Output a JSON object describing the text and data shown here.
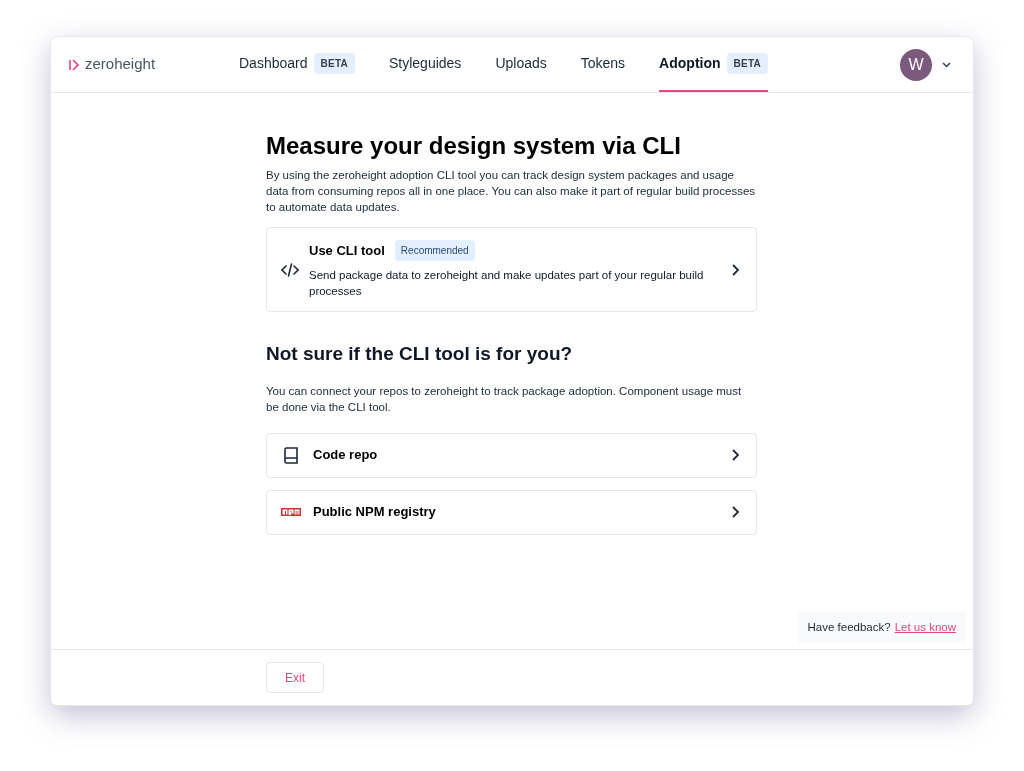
{
  "brand": {
    "name": "zeroheight"
  },
  "nav": [
    {
      "label": "Dashboard",
      "badge": "BETA",
      "selected": false
    },
    {
      "label": "Styleguides",
      "selected": false
    },
    {
      "label": "Uploads",
      "selected": false
    },
    {
      "label": "Tokens",
      "selected": false
    },
    {
      "label": "Adoption",
      "badge": "BETA",
      "selected": true
    }
  ],
  "user": {
    "initial": "W"
  },
  "heading": "Measure your design system via CLI",
  "intro": "By using the zeroheight adoption CLI tool you can track design system packages and usage data from consuming repos all in one place. You can also make it part of regular build processes to automate data updates.",
  "primary_options": [
    {
      "kind": "code",
      "title": "Use CLI tool",
      "badge": "Recommended",
      "description": "Send package data to zeroheight and make updates part of your regular build processes"
    }
  ],
  "secondary_heading": "Not sure if the CLI tool is for you?",
  "secondary_intro": "You can connect your repos to zeroheight to track package adoption. Component usage must be done via the CLI tool.",
  "secondary_options": [
    {
      "kind": "book",
      "title": "Code repo"
    },
    {
      "kind": "npm",
      "title": "Public NPM registry"
    }
  ],
  "feedback": {
    "text": "Have feedback?",
    "link": "Let us know"
  },
  "footer": {
    "button": "Exit"
  }
}
